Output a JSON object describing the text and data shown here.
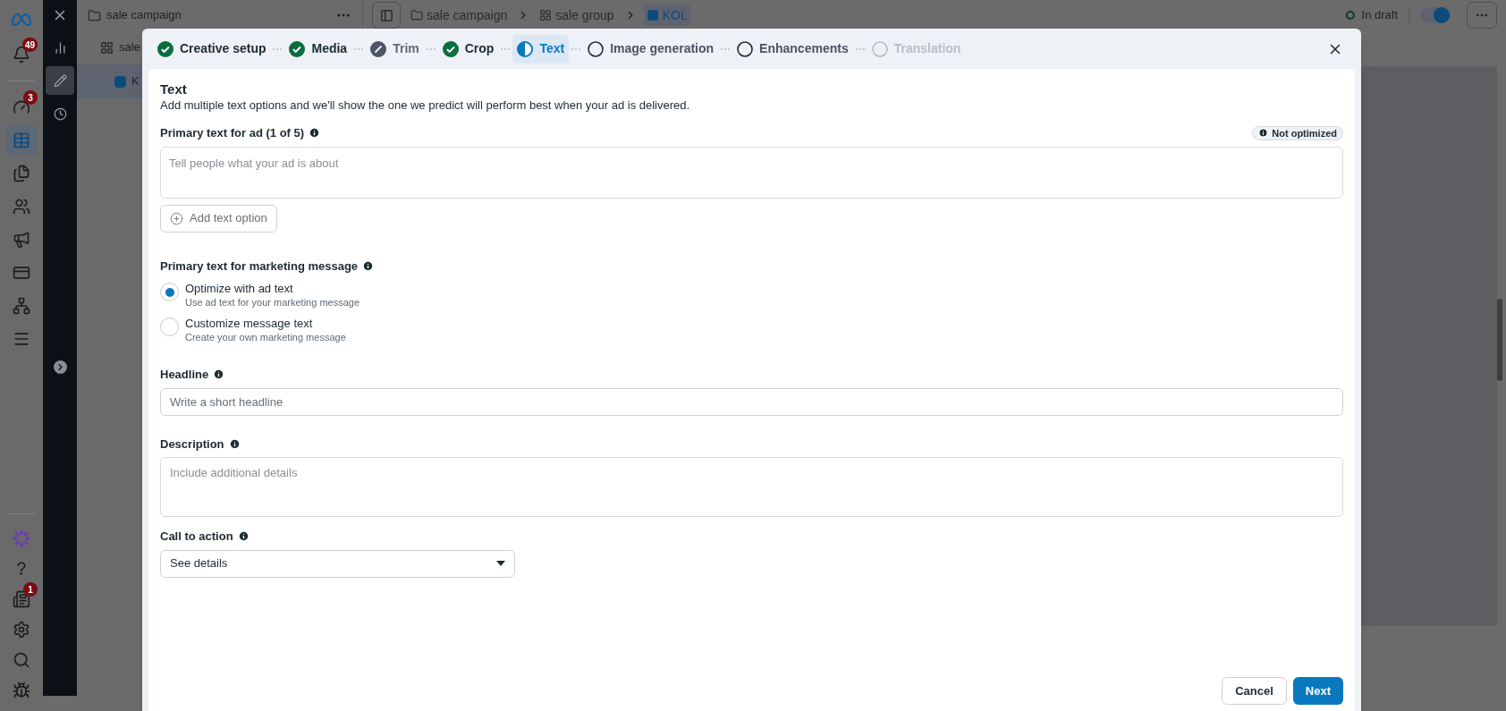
{
  "rail": {
    "top_items": [
      {
        "kind": "bell",
        "badge": "49",
        "selected": false
      }
    ],
    "items": [
      {
        "kind": "gauge",
        "badge": "3",
        "selected": false
      },
      {
        "kind": "table",
        "selected": true
      },
      {
        "kind": "pages",
        "selected": false
      },
      {
        "kind": "people",
        "selected": false
      },
      {
        "kind": "megaphone",
        "selected": false
      },
      {
        "kind": "card",
        "selected": false
      },
      {
        "kind": "network",
        "selected": false
      },
      {
        "kind": "menu",
        "selected": false
      }
    ],
    "bottom_items": [
      {
        "kind": "flower"
      },
      {
        "kind": "help"
      },
      {
        "kind": "news",
        "badge": "1"
      },
      {
        "kind": "settings"
      },
      {
        "kind": "search"
      },
      {
        "kind": "bug"
      }
    ]
  },
  "tools": [
    {
      "kind": "chart",
      "selected": false
    },
    {
      "kind": "pencil",
      "selected": true
    },
    {
      "kind": "clock",
      "selected": false
    }
  ],
  "tree": {
    "title": "sale campaign",
    "rows": [
      {
        "kind": "group",
        "label": "sale"
      },
      {
        "kind": "ad",
        "label": "K"
      }
    ]
  },
  "top_bar": {
    "breadcrumb": [
      {
        "kind": "campaign",
        "label": "sale campaign"
      },
      {
        "kind": "group",
        "label": "sale group"
      },
      {
        "kind": "ad",
        "label": "KOL"
      }
    ],
    "status": "In draft",
    "toggle": {
      "on": true
    }
  },
  "modal": {
    "steps": [
      {
        "label": "Creative setup",
        "kind": "done",
        "selected": false
      },
      {
        "label": "Media",
        "kind": "done",
        "selected": false
      },
      {
        "label": "Trim",
        "kind": "edited",
        "selected": false
      },
      {
        "label": "Crop",
        "kind": "done",
        "selected": false
      },
      {
        "label": "Text",
        "kind": "partial",
        "selected": true
      },
      {
        "label": "Image generation",
        "kind": "pending",
        "selected": false
      },
      {
        "label": "Enhancements",
        "kind": "pending",
        "selected": false
      },
      {
        "label": "Translation",
        "kind": "disabled",
        "selected": false
      }
    ],
    "section_title": "Text",
    "section_description": "Add multiple text options and we'll show the one we predict will perform best when your ad is delivered.",
    "primary_text": {
      "label": "Primary text for ad (1 of 5)",
      "badge": "Not optimized",
      "placeholder": "Tell people what your ad is about",
      "add_button": "Add text option"
    },
    "marketing_message": {
      "label": "Primary text for marketing message",
      "options": [
        {
          "label": "Optimize with ad text",
          "sub": "Use ad text for your marketing message",
          "selected": true
        },
        {
          "label": "Customize message text",
          "sub": "Create your own marketing message",
          "selected": false
        }
      ]
    },
    "headline": {
      "label": "Headline",
      "placeholder": "Write a short headline"
    },
    "description": {
      "label": "Description",
      "placeholder": "Include additional details"
    },
    "call_to_action": {
      "label": "Call to action",
      "value": "See details"
    },
    "buttons": {
      "cancel": "Cancel",
      "next": "Next"
    }
  }
}
